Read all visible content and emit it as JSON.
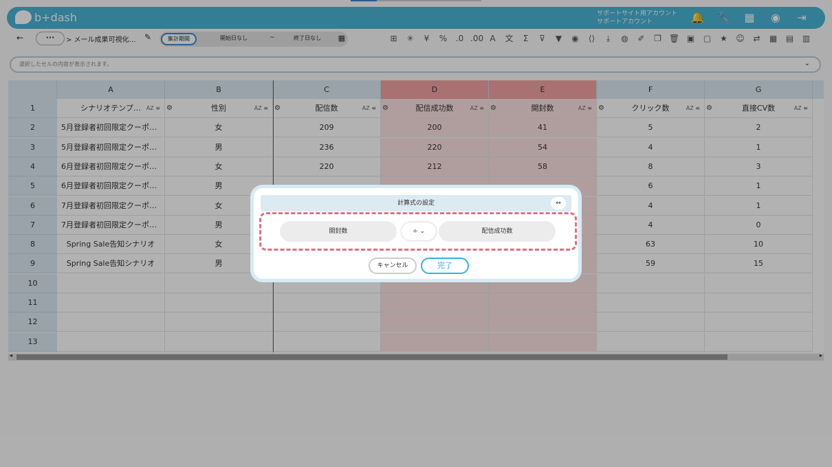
{
  "app": {
    "logo_text": "b+dash",
    "account_line1": "サポートサイト用アカウント",
    "account_line2": "サポートアカウント"
  },
  "toolbar": {
    "back": "←",
    "more": "···",
    "breadcrumb": "> メール成果可視化…",
    "period_label": "集計期間",
    "start_date": "開始日なし",
    "tilde": "~",
    "end_date": "終了日なし"
  },
  "selection_bar": {
    "placeholder": "選択したセルの内容が表示されます。"
  },
  "grid": {
    "columns": [
      "A",
      "B",
      "C",
      "D",
      "E",
      "F",
      "G"
    ],
    "header_row_num": "1",
    "headers": [
      "シナリオテンプ…",
      "性別",
      "配信数",
      "配信成功数",
      "開封数",
      "クリック数",
      "直接CV数"
    ],
    "sort_label": "AZ",
    "rows": [
      {
        "num": "2",
        "cells": [
          "5月登録者初回限定クーポ…",
          "女",
          "209",
          "200",
          "41",
          "5",
          "2"
        ]
      },
      {
        "num": "3",
        "cells": [
          "5月登録者初回限定クーポ…",
          "男",
          "236",
          "220",
          "54",
          "4",
          "1"
        ]
      },
      {
        "num": "4",
        "cells": [
          "6月登録者初回限定クーポ…",
          "女",
          "220",
          "212",
          "58",
          "8",
          "3"
        ]
      },
      {
        "num": "5",
        "cells": [
          "6月登録者初回限定クーポ…",
          "男",
          "",
          "",
          "",
          "6",
          "1"
        ]
      },
      {
        "num": "6",
        "cells": [
          "7月登録者初回限定クーポ…",
          "女",
          "",
          "",
          "",
          "4",
          "1"
        ]
      },
      {
        "num": "7",
        "cells": [
          "7月登録者初回限定クーポ…",
          "男",
          "",
          "",
          "",
          "4",
          "0"
        ]
      },
      {
        "num": "8",
        "cells": [
          "Spring Sale告知シナリオ",
          "女",
          "",
          "",
          "",
          "63",
          "10"
        ]
      },
      {
        "num": "9",
        "cells": [
          "Spring Sale告知シナリオ",
          "男",
          "",
          "",
          "",
          "59",
          "15"
        ]
      },
      {
        "num": "10",
        "cells": [
          "",
          "",
          "",
          "",
          "",
          "",
          ""
        ]
      },
      {
        "num": "11",
        "cells": [
          "",
          "",
          "",
          "",
          "",
          "",
          ""
        ]
      },
      {
        "num": "12",
        "cells": [
          "",
          "",
          "",
          "",
          "",
          "",
          ""
        ]
      },
      {
        "num": "13",
        "cells": [
          "",
          "",
          "",
          "",
          "",
          "",
          ""
        ]
      }
    ]
  },
  "modal": {
    "title": "計算式の設定",
    "expand_icon": "↔",
    "left_operand": "開封数",
    "operator": "÷",
    "right_operand": "配信成功数",
    "cancel_label": "キャンセル",
    "done_label": "完了"
  }
}
